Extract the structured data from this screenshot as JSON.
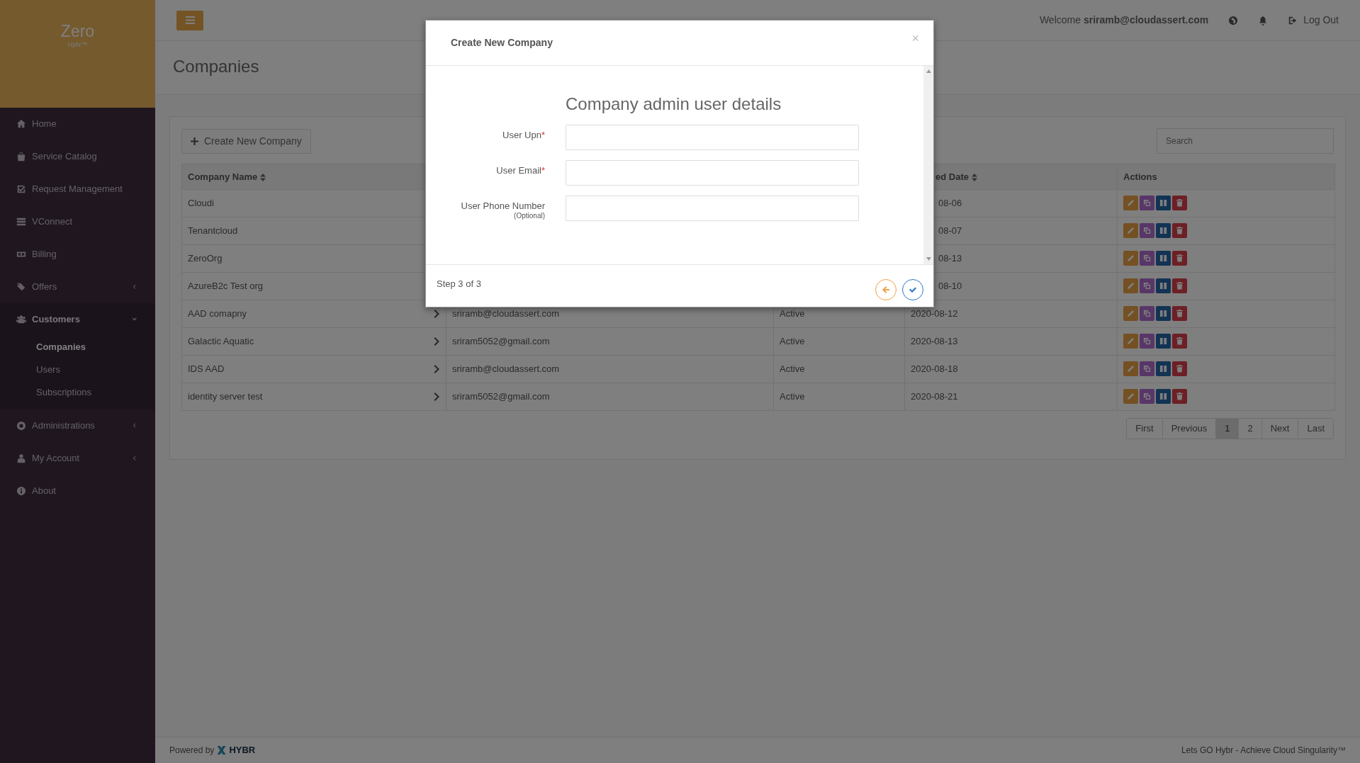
{
  "sidebar": {
    "logo": "Zero",
    "logo_sub": "Hybr™",
    "items": [
      {
        "label": "Home",
        "kind": "link",
        "selected": false
      },
      {
        "label": "Service Catalog",
        "kind": "link",
        "selected": false
      },
      {
        "label": "Request Management",
        "kind": "link",
        "selected": false
      },
      {
        "label": "VConnect",
        "kind": "link",
        "selected": false
      },
      {
        "label": "Billing",
        "kind": "link",
        "selected": false
      },
      {
        "label": "Offers",
        "kind": "menu",
        "selected": false,
        "expanded": false
      },
      {
        "label": "Customers",
        "kind": "menu",
        "selected": true,
        "expanded": true,
        "children": [
          {
            "label": "Companies",
            "selected": true
          },
          {
            "label": "Users",
            "selected": false
          },
          {
            "label": "Subscriptions",
            "selected": false
          }
        ]
      },
      {
        "label": "Administrations",
        "kind": "menu",
        "selected": false,
        "expanded": false
      },
      {
        "label": "My Account",
        "kind": "menu",
        "selected": false,
        "expanded": false
      },
      {
        "label": "About",
        "kind": "link",
        "selected": false
      }
    ]
  },
  "header": {
    "welcome": "Welcome **sriramb@cloudassert.com**",
    "logout": "Log Out"
  },
  "page_title": "Companies",
  "toolbar": {
    "create_button": "Create New Company",
    "search": {
      "placeholder": "Search"
    }
  },
  "table": {
    "columns": [
      {
        "label": "Company Name",
        "kind": "name",
        "sortable": true
      },
      {
        "label": "ed Date",
        "kind": "date",
        "sortable": true
      },
      {
        "label": "Actions",
        "kind": "actions",
        "sortable": false
      }
    ],
    "rows": [
      {
        "name": "Cloudi",
        "date": "08-06"
      },
      {
        "name": "Tenantcloud",
        "date": "08-07"
      },
      {
        "name": "ZeroOrg",
        "date": "08-13"
      },
      {
        "name": "AzureB2c Test org",
        "date": "08-10"
      },
      {
        "name": "AAD comapny",
        "email": "sriramb@cloudassert.com",
        "status": "Active",
        "date": "2020-08-12"
      },
      {
        "name": "Galactic Aquatic",
        "email": "sriram5052@gmail.com",
        "status": "Active",
        "date": "2020-08-13"
      },
      {
        "name": "IDS AAD",
        "email": "sriramb@cloudassert.com",
        "status": "Active",
        "date": "2020-08-18"
      },
      {
        "name": "identity server test",
        "email": "sriram5052@gmail.com",
        "status": "Active",
        "date": "2020-08-21"
      }
    ]
  },
  "pagination": [
    {
      "label": "First",
      "selected": false
    },
    {
      "label": "Previous",
      "selected": false
    },
    {
      "label": "1",
      "selected": true
    },
    {
      "label": "2",
      "selected": false
    },
    {
      "label": "Next",
      "selected": false
    },
    {
      "label": "Last",
      "selected": false
    }
  ],
  "modal": {
    "title": "Create New Company",
    "close": "×",
    "heading": "Company admin user details",
    "fields": [
      {
        "label": "User Upn",
        "required_mark": "*"
      },
      {
        "label": "User Email",
        "required_mark": "*"
      },
      {
        "label": "User Phone Number",
        "note": "(Optional)"
      }
    ],
    "step": "Step 3 of 3"
  },
  "footer": {
    "powered": "Powered by",
    "brand": "HYBR",
    "tagline": "Lets GO Hybr - Achieve Cloud Singularity™"
  }
}
